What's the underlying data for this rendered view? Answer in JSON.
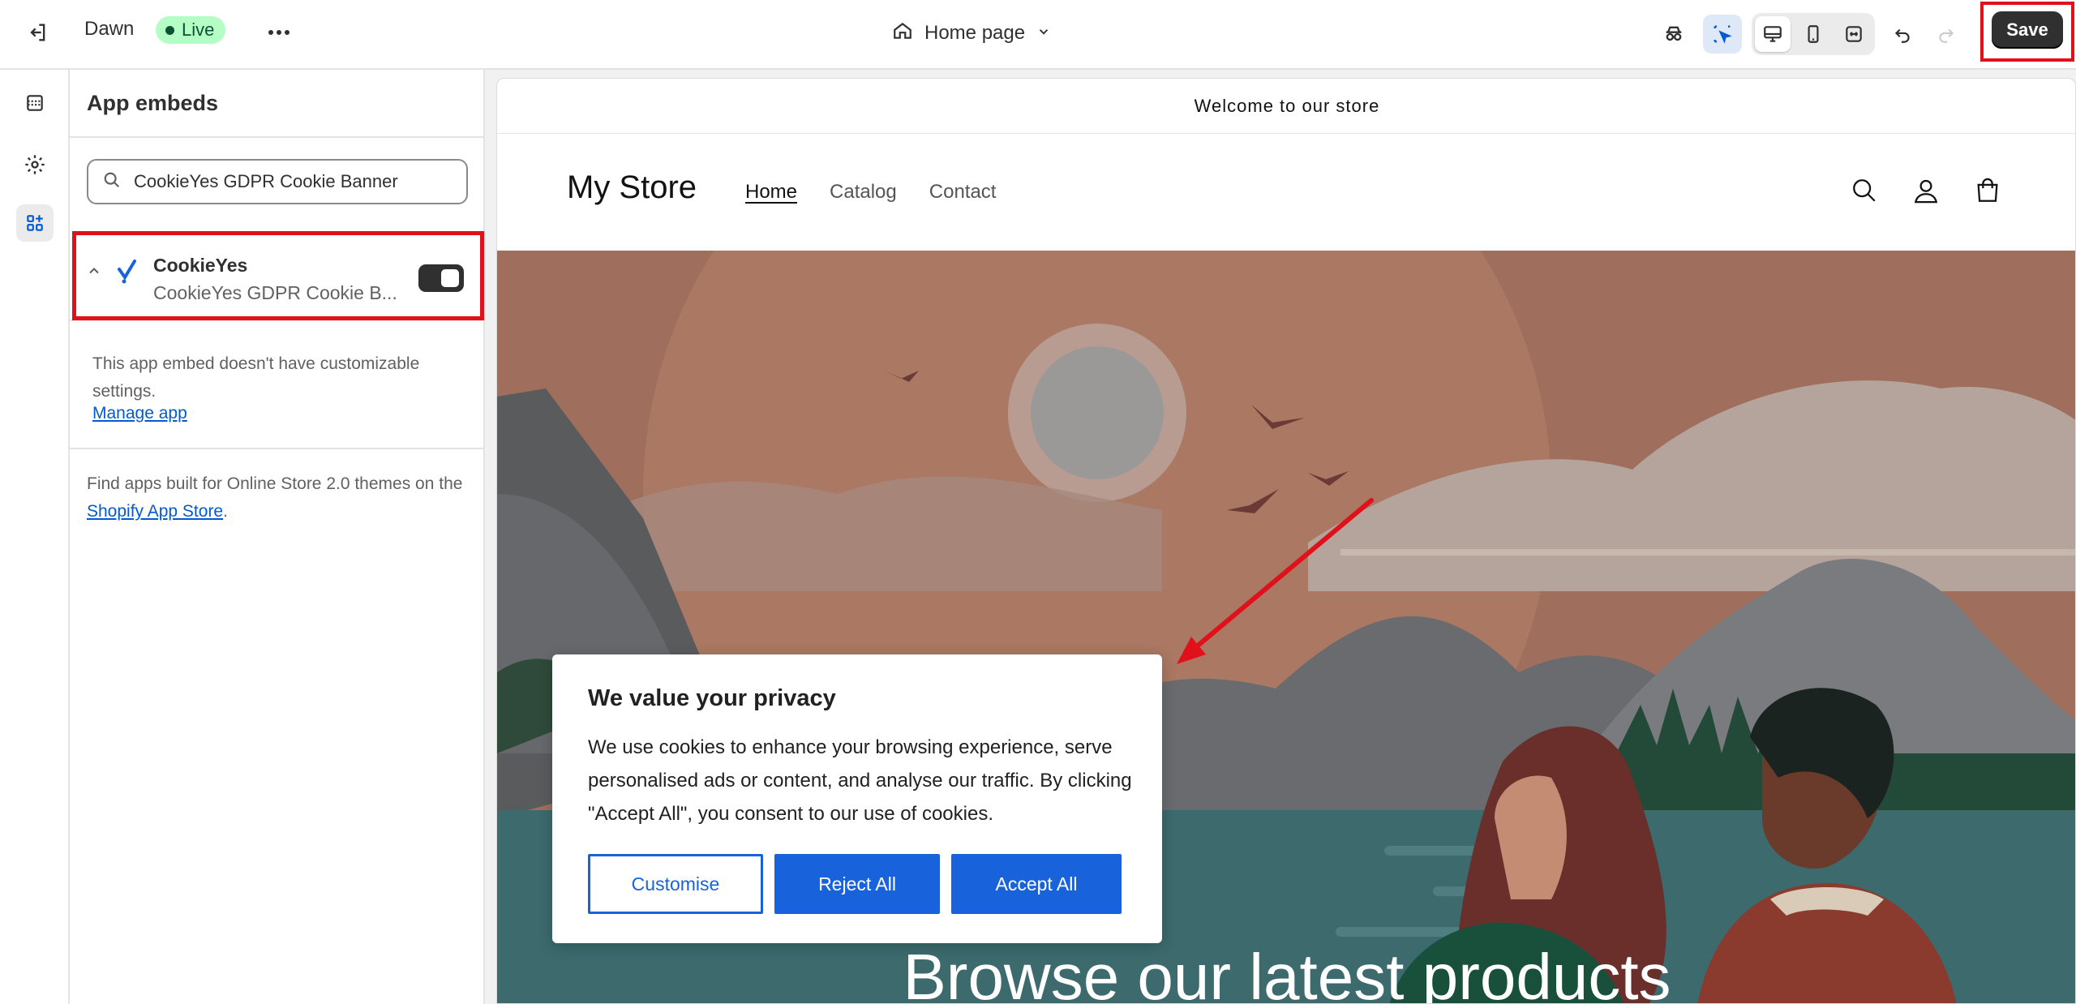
{
  "topbar": {
    "theme_name": "Dawn",
    "status": "Live",
    "page_selector": "Home page",
    "save_label": "Save"
  },
  "panel": {
    "title": "App embeds",
    "search_value": "CookieYes GDPR Cookie Banner",
    "embed": {
      "app_name": "CookieYes",
      "embed_name": "CookieYes GDPR Cookie B...",
      "enabled": true
    },
    "info_text": "This app embed doesn't have customizable settings.",
    "manage_link": "Manage app",
    "find_text_prefix": "Find apps built for Online Store 2.0 themes on the ",
    "find_link": "Shopify App Store",
    "find_text_suffix": "."
  },
  "preview": {
    "announcement": "Welcome to our store",
    "store_name": "My Store",
    "nav": [
      "Home",
      "Catalog",
      "Contact"
    ],
    "hero_title": "Browse our latest products",
    "cookie_banner": {
      "title": "We value your privacy",
      "body": "We use cookies to enhance your browsing experience, serve personalised ads or content, and analyse our traffic. By clicking \"Accept All\", you consent to our use of cookies.",
      "customise": "Customise",
      "reject": "Reject All",
      "accept": "Accept All"
    }
  },
  "colors": {
    "highlight": "#e0111a",
    "cookie_blue": "#1863dc",
    "live_badge": "#b4fec5"
  }
}
